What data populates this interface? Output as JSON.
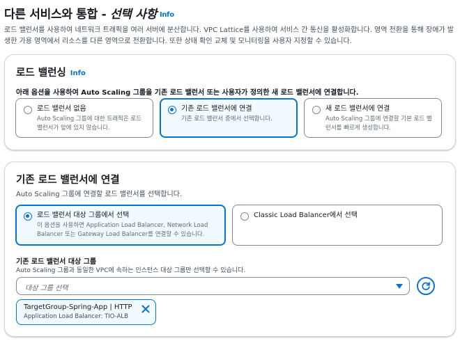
{
  "header": {
    "title_main": "다른 서비스와 통합 - ",
    "title_italic": "선택 사항",
    "info": "Info",
    "description": "로드 밸런서를 사용하여 네트워크 트래픽을 여러 서버에 분산합니다. VPC Lattice를 사용하여 서비스 간 통신을 활성화합니다. 영역 전환을 통해 장애가 발생한 가용 영역에서 리소스를 다른 영역으로 전환합니다. 또한 상태 확인 교체 및 모니터링을 사용자 지정할 수 있습니다."
  },
  "load_balancing": {
    "title": "로드 밸런싱",
    "info": "Info",
    "question": "아래 옵션을 사용하여 Auto Scaling 그룹을 기존 로드 밸런서 또는 사용자가 정의한 새 로드 밸런서에 연결합니다.",
    "options": [
      {
        "title": "로드 밸런서 없음",
        "desc": "Auto Scaling 그룹에 대한 트래픽은 로드 밸런서가 앞에 있지 않습니다.",
        "selected": false
      },
      {
        "title": "기존 로드 밸런서에 연결",
        "desc": "기존 로드 밸런서 중에서 선택합니다.",
        "selected": true
      },
      {
        "title": "새 로드 밸런서에 연결",
        "desc": "Auto Scaling 그룹에 연결할 기본 로드 밸런서를 빠르게 생성합니다.",
        "selected": false
      }
    ]
  },
  "existing_lb": {
    "title": "기존 로드 밸런서에 연결",
    "subtitle": "Auto Scaling 그룹에 연결할 로드 밸런서를 선택합니다.",
    "options": [
      {
        "title": "로드 밸런서 대상 그룹에서 선택",
        "desc": "이 옵션을 사용하면 Application Load Balancer, Network Load Balancer 또는 Gateway Load Balancer를 연결할 수 있습니다.",
        "selected": true
      },
      {
        "title": "Classic Load Balancer에서 선택",
        "desc": "",
        "selected": false
      }
    ],
    "target_group_label": "기존 로드 밸런서 대상 그룹",
    "target_group_desc": "Auto Scaling 그룹과 동일한 VPC에 속하는 인스턴스 대상 그룹만 선택할 수 있습니다.",
    "select_placeholder": "대상 그룹 선택",
    "token": {
      "title": "TargetGroup-Spring-App | HTTP",
      "desc": "Application Load Balancer: TIO-ALB"
    }
  },
  "colors": {
    "accent": "#0972d3",
    "selected_bg": "#f1faff",
    "border": "#7d8998",
    "text": "#16191f"
  }
}
